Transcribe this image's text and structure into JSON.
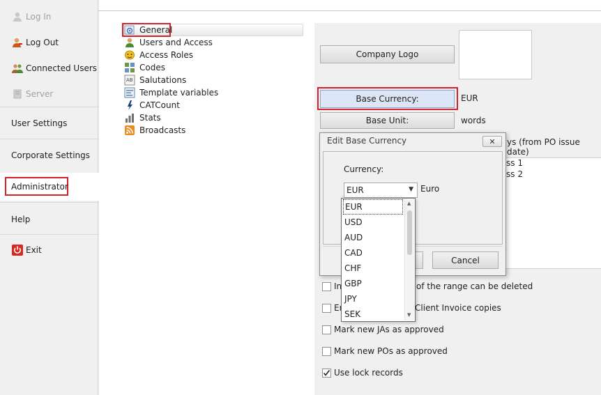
{
  "nav": {
    "login": "Log In",
    "logout": "Log Out",
    "connected_users": "Connected Users",
    "server": "Server",
    "user_settings": "User Settings",
    "corporate_settings": "Corporate Settings",
    "administrator": "Administrator",
    "help": "Help",
    "exit": "Exit"
  },
  "tree": [
    {
      "label": "General",
      "icon": "general-icon"
    },
    {
      "label": "Users and Access",
      "icon": "user-icon"
    },
    {
      "label": "Access Roles",
      "icon": "role-mask-icon"
    },
    {
      "label": "Codes",
      "icon": "codes-icon"
    },
    {
      "label": "Salutations",
      "icon": "salutations-icon"
    },
    {
      "label": "Template variables",
      "icon": "template-icon"
    },
    {
      "label": "CATCount",
      "icon": "catcount-icon"
    },
    {
      "label": "Stats",
      "icon": "stats-icon"
    },
    {
      "label": "Broadcasts",
      "icon": "rss-icon"
    }
  ],
  "panel": {
    "company_logo": "Company Logo",
    "base_currency_btn": "Base Currency:",
    "base_currency_value": "EUR",
    "base_unit_btn": "Base Unit:",
    "base_unit_value": "words",
    "partial_days_text": "ys (from PO issue date)",
    "partial_class1": "ss 1",
    "partial_class2": "ss 2",
    "chk1_prefix": "In",
    "chk1_suffix": "of the range can be deleted",
    "chk2_prefix": "Er",
    "chk2_suffix": "Client Invoice copies",
    "chk3": "Mark new JAs as approved",
    "chk4": "Mark new POs as approved",
    "chk5": "Use lock records"
  },
  "dialog": {
    "title": "Edit Base Currency",
    "close": "✕",
    "currency_label": "Currency:",
    "combo_value": "EUR",
    "combo_desc": "Euro",
    "cancel": "Cancel",
    "options": [
      "EUR",
      "USD",
      "AUD",
      "CAD",
      "CHF",
      "GBP",
      "JPY",
      "SEK"
    ]
  },
  "colors": {
    "highlight_red": "#d4202a",
    "nav_bg": "#f0f0f0",
    "panel_bg": "#f0f0f0",
    "selected_btn": "#dce6f7"
  }
}
